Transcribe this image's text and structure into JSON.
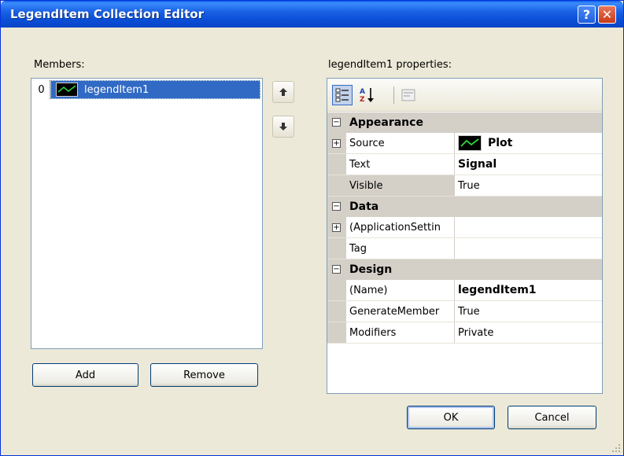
{
  "window": {
    "title": "LegendItem Collection Editor",
    "help_glyph": "?",
    "close_glyph": "✕"
  },
  "members": {
    "label": "Members:",
    "items": [
      {
        "index": "0",
        "label": "legendItem1",
        "icon": "plot-icon"
      }
    ]
  },
  "buttons": {
    "add": "Add",
    "remove": "Remove",
    "ok": "OK",
    "cancel": "Cancel",
    "move_up_icon": "arrow-up-icon",
    "move_down_icon": "arrow-down-icon"
  },
  "properties": {
    "label": "legendItem1 properties:",
    "toolbar": [
      "categorized-icon",
      "alphabetical-icon",
      "property-pages-icon"
    ],
    "categories": [
      {
        "name": "Appearance",
        "rows": [
          {
            "name": "Source",
            "value": "Plot",
            "expandable": true,
            "bold": true,
            "icon": "plot-icon"
          },
          {
            "name": "Text",
            "value": "Signal",
            "expandable": false,
            "bold": true
          },
          {
            "name": "Visible",
            "value": "True",
            "expandable": false,
            "bold": false,
            "selected": true
          }
        ]
      },
      {
        "name": "Data",
        "rows": [
          {
            "name": "(ApplicationSettin",
            "value": "",
            "expandable": true,
            "bold": false
          },
          {
            "name": "Tag",
            "value": "",
            "expandable": false,
            "bold": false
          }
        ]
      },
      {
        "name": "Design",
        "rows": [
          {
            "name": "(Name)",
            "value": "legendItem1",
            "expandable": false,
            "bold": true
          },
          {
            "name": "GenerateMember",
            "value": "True",
            "expandable": false,
            "bold": false
          },
          {
            "name": "Modifiers",
            "value": "Private",
            "expandable": false,
            "bold": false
          }
        ]
      }
    ]
  },
  "colors": {
    "selection": "#316ac5",
    "titlebar": "#0a4fd8",
    "dialog_bg": "#ece9d8"
  }
}
